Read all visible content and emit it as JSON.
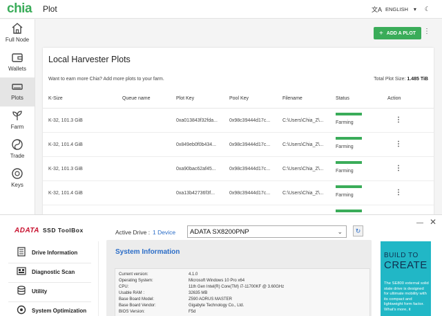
{
  "chia": {
    "logo": "chia",
    "page_title": "Plot",
    "language": "ENGLISH",
    "nav": [
      {
        "label": "Full Node",
        "icon": "home-icon"
      },
      {
        "label": "Wallets",
        "icon": "wallet-icon"
      },
      {
        "label": "Plots",
        "icon": "drive-icon"
      },
      {
        "label": "Farm",
        "icon": "sprout-icon"
      },
      {
        "label": "Trade",
        "icon": "trade-icon"
      },
      {
        "label": "Keys",
        "icon": "keys-icon"
      }
    ],
    "active_nav": "Plots",
    "add_plot_label": "ADD A PLOT",
    "card_title": "Local Harvester Plots",
    "card_subtitle": "Want to earn more Chia? Add more plots to your farm.",
    "total_plot_size_label": "Total Plot Size:",
    "total_plot_size": "1.485 TiB",
    "columns": [
      "K-Size",
      "Queue name",
      "Plot Key",
      "Pool Key",
      "Filename",
      "Status",
      "Action"
    ],
    "rows": [
      {
        "ksize": "K-32, 101.3 GiB",
        "queue": "",
        "plot_key": "0xa013843f32fda...",
        "pool_key": "0x98c39444d17c...",
        "filename": "C:\\Users\\Chia_Z\\...",
        "status": "Farming"
      },
      {
        "ksize": "K-32, 101.4 GiB",
        "queue": "",
        "plot_key": "0x849eb0f0b434...",
        "pool_key": "0x98c39444d17c...",
        "filename": "C:\\Users\\Chia_Z\\...",
        "status": "Farming"
      },
      {
        "ksize": "K-32, 101.3 GiB",
        "queue": "",
        "plot_key": "0xa90bac62af45...",
        "pool_key": "0x98c39444d17c...",
        "filename": "C:\\Users\\Chia_Z\\...",
        "status": "Farming"
      },
      {
        "ksize": "K-32, 101.4 GiB",
        "queue": "",
        "plot_key": "0xa13b42736f3f...",
        "pool_key": "0x98c39444d17c...",
        "filename": "C:\\Users\\Chia_Z\\...",
        "status": "Farming"
      }
    ],
    "colors": {
      "accent": "#3aac59"
    }
  },
  "adata": {
    "logo": "ADATA",
    "product": "SSD ToolBox",
    "active_drive_label": "Active Drive :",
    "device_count": "1 Device",
    "selected_drive": "ADATA SX8200PNP",
    "menu": [
      {
        "label": "Drive Information",
        "icon": "drive-info-icon"
      },
      {
        "label": "Diagnostic Scan",
        "icon": "diagnostic-icon"
      },
      {
        "label": "Utility",
        "icon": "utility-icon"
      },
      {
        "label": "System Optimization",
        "icon": "optimization-icon"
      }
    ],
    "panel_title": "System Information",
    "system_info": [
      {
        "label": "Current version:",
        "value": "4.1.0"
      },
      {
        "label": "Operating System:",
        "value": "Microsoft Windows 10 Pro x64"
      },
      {
        "label": "CPU:",
        "value": "11th Gen Intel(R) Core(TM) i7-11700KF @ 3.60GHz"
      },
      {
        "label": "Usable RAM :",
        "value": "32635 MB"
      },
      {
        "label": "Base Board Model:",
        "value": "Z590 AORUS MASTER"
      },
      {
        "label": "Base Board Vendor:",
        "value": "Gigabyte Technology Co., Ltd."
      },
      {
        "label": "BIOS Version:",
        "value": "F5d"
      }
    ],
    "ad": {
      "line1": "BUILD TO",
      "line2": "CREATE",
      "body": "The SE800 external solid state drive is designed for ultimate mobility with its compact and lightweight form factor. What's more, it"
    },
    "colors": {
      "brand": "#c8102e",
      "link": "#2a6cc7",
      "ad_bg": "#21b7c6"
    }
  }
}
